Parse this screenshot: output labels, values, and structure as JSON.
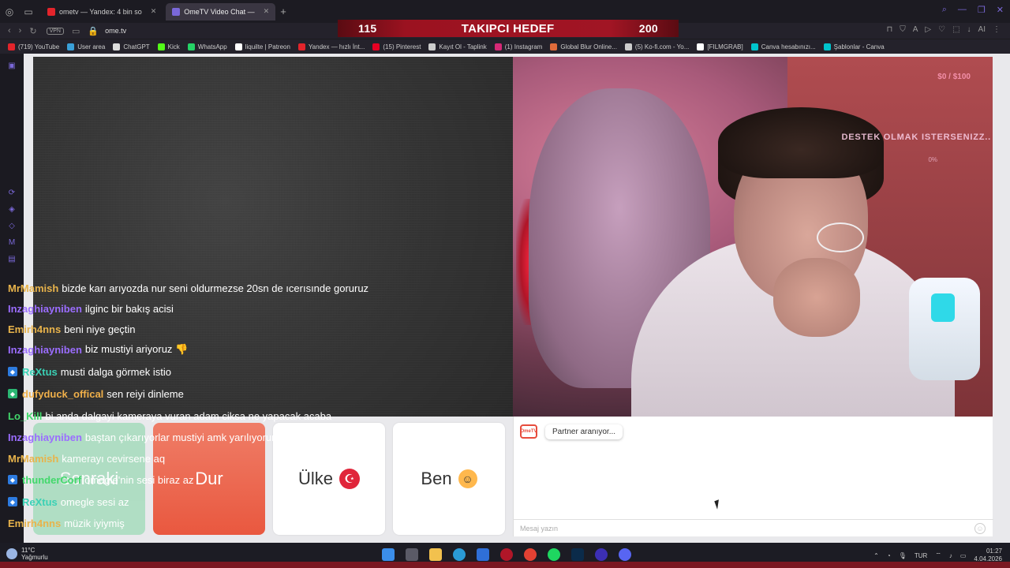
{
  "browser": {
    "tabs": [
      {
        "label": "ometv — Yandex: 4 bin so",
        "active": false,
        "color": "#e3242b"
      },
      {
        "label": "OmeTV Video Chat —",
        "active": true,
        "color": "#7a68d8"
      }
    ],
    "url": "ome.tv",
    "vpn_label": "VPN"
  },
  "banner": {
    "left": "115",
    "title": "TAKIPCI HEDEF",
    "right": "200"
  },
  "bookmarks": [
    {
      "label": "(719) YouTube",
      "color": "#e3242b"
    },
    {
      "label": "User area",
      "color": "#3aa0d8"
    },
    {
      "label": "ChatGPT",
      "color": "#dddddd"
    },
    {
      "label": "Kick",
      "color": "#53fc18"
    },
    {
      "label": "WhatsApp",
      "color": "#25d366"
    },
    {
      "label": "liquilte | Patreon",
      "color": "#ffffff"
    },
    {
      "label": "Yandex — hızlı İnt...",
      "color": "#e3242b"
    },
    {
      "label": "(15) Pinterest",
      "color": "#e60023"
    },
    {
      "label": "Kayıt Ol - Taplink",
      "color": "#cccccc"
    },
    {
      "label": "(1) Instagram",
      "color": "#d62976"
    },
    {
      "label": "Global Blur Online...",
      "color": "#e06b3a"
    },
    {
      "label": "(5) Ko-fi.com - Yo...",
      "color": "#cccccc"
    },
    {
      "label": "[FILMGRAB]",
      "color": "#ffffff"
    },
    {
      "label": "Canva hesabınızı...",
      "color": "#00c4cc"
    },
    {
      "label": "Şablonlar - Canva",
      "color": "#00c4cc"
    }
  ],
  "stream_overlay": {
    "money": "$0 / $100",
    "support": "DESTEK OLMAK ISTERSENIZZ..",
    "percent": "0%"
  },
  "chat": [
    {
      "user": "MrMamish",
      "msg": "bizde karı arıyozda nur seni oldurmezse 20sn de ıcerısınde goruruz",
      "color": "#e8b34b",
      "badge": ""
    },
    {
      "user": "Inzaghiayniben",
      "msg": "ilginc bir bakış acisi",
      "color": "#9b6dff",
      "badge": ""
    },
    {
      "user": "Emirh4nns",
      "msg": "beni niye geçtin",
      "color": "#e8b34b",
      "badge": ""
    },
    {
      "user": "Inzaghiayniben",
      "msg": "biz mustiyi ariyoruz 👎",
      "color": "#9b6dff",
      "badge": ""
    },
    {
      "user": "ReXtus",
      "msg": "musti dalga görmek istio",
      "color": "#3ad1b5",
      "badge": "#2d7be0"
    },
    {
      "user": "dufyduck_offical",
      "msg": "sen reiyi dinleme",
      "color": "#f0b04a",
      "badge": "#2bb673"
    },
    {
      "user": "Lo_Kill",
      "msg": "bi anda dalgayi kameraya vuran adam ciksa ne yapacak acaba",
      "color": "#42d86b",
      "badge": ""
    },
    {
      "user": "Inzaghiayniben",
      "msg": "baştan çıkarıyorlar mustiyi amk yarılıyorum",
      "color": "#9b6dff",
      "badge": ""
    },
    {
      "user": "MrMamish",
      "msg": "kamerayı cevirsene aq",
      "color": "#e8b34b",
      "badge": ""
    },
    {
      "user": "thunderCorf",
      "msg": "omegle'nin sesi biraz az",
      "color": "#42d86b",
      "badge": "#2d7be0"
    },
    {
      "user": "ReXtus",
      "msg": "omegle sesi az",
      "color": "#3ad1b5",
      "badge": "#2d7be0"
    },
    {
      "user": "Emirh4nns",
      "msg": "müzik iyiymiş",
      "color": "#e8b34b",
      "badge": ""
    }
  ],
  "buttons": {
    "next": "Sonraki",
    "stop": "Dur",
    "country": "Ülke",
    "me": "Ben"
  },
  "panel": {
    "status": "Partner aranıyor...",
    "placeholder": "Mesaj yazın",
    "logo": "OmeTV"
  },
  "taskbar": {
    "temp": "11°C",
    "weather": "Yağmurlu",
    "lang": "TUR",
    "time": "01:27",
    "date": "4.04.2026"
  }
}
